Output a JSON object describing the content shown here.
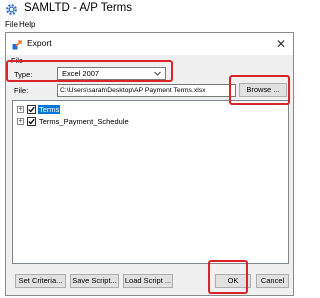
{
  "app": {
    "title": "SAMLTD - A/P Terms",
    "menu": [
      "File",
      "Help"
    ]
  },
  "dialog": {
    "title": "Export",
    "close_glyph": "✕",
    "file_group_label": "File",
    "type_label": "Type:",
    "type_value": "Excel 2007",
    "file_label": "File:",
    "file_value": "C:\\Users\\sarah\\Desktop\\AP Payment Terms.xlsx",
    "browse_label": "Browse ...",
    "tree": [
      {
        "label": "Terms",
        "checked": true,
        "selected": true,
        "expander": "+"
      },
      {
        "label": "Terms_Payment_Schedule",
        "checked": true,
        "selected": false,
        "expander": "+"
      }
    ],
    "buttons": {
      "set_criteria": "Set Criteria...",
      "save_script": "Save Script...",
      "load_script": "Load Script ...",
      "ok": "OK",
      "cancel": "Cancel"
    }
  },
  "icons": {
    "app_icon": "gear-icon",
    "dialog_icon": "export-icon",
    "dropdown": "chevron-down-icon",
    "close": "close-icon"
  },
  "colors": {
    "highlight": "#d9242c",
    "selection": "#0078d7",
    "app_icon": "#2f6fc4",
    "export_icon_blue": "#1e6fd9",
    "export_icon_orange": "#e8792c"
  }
}
